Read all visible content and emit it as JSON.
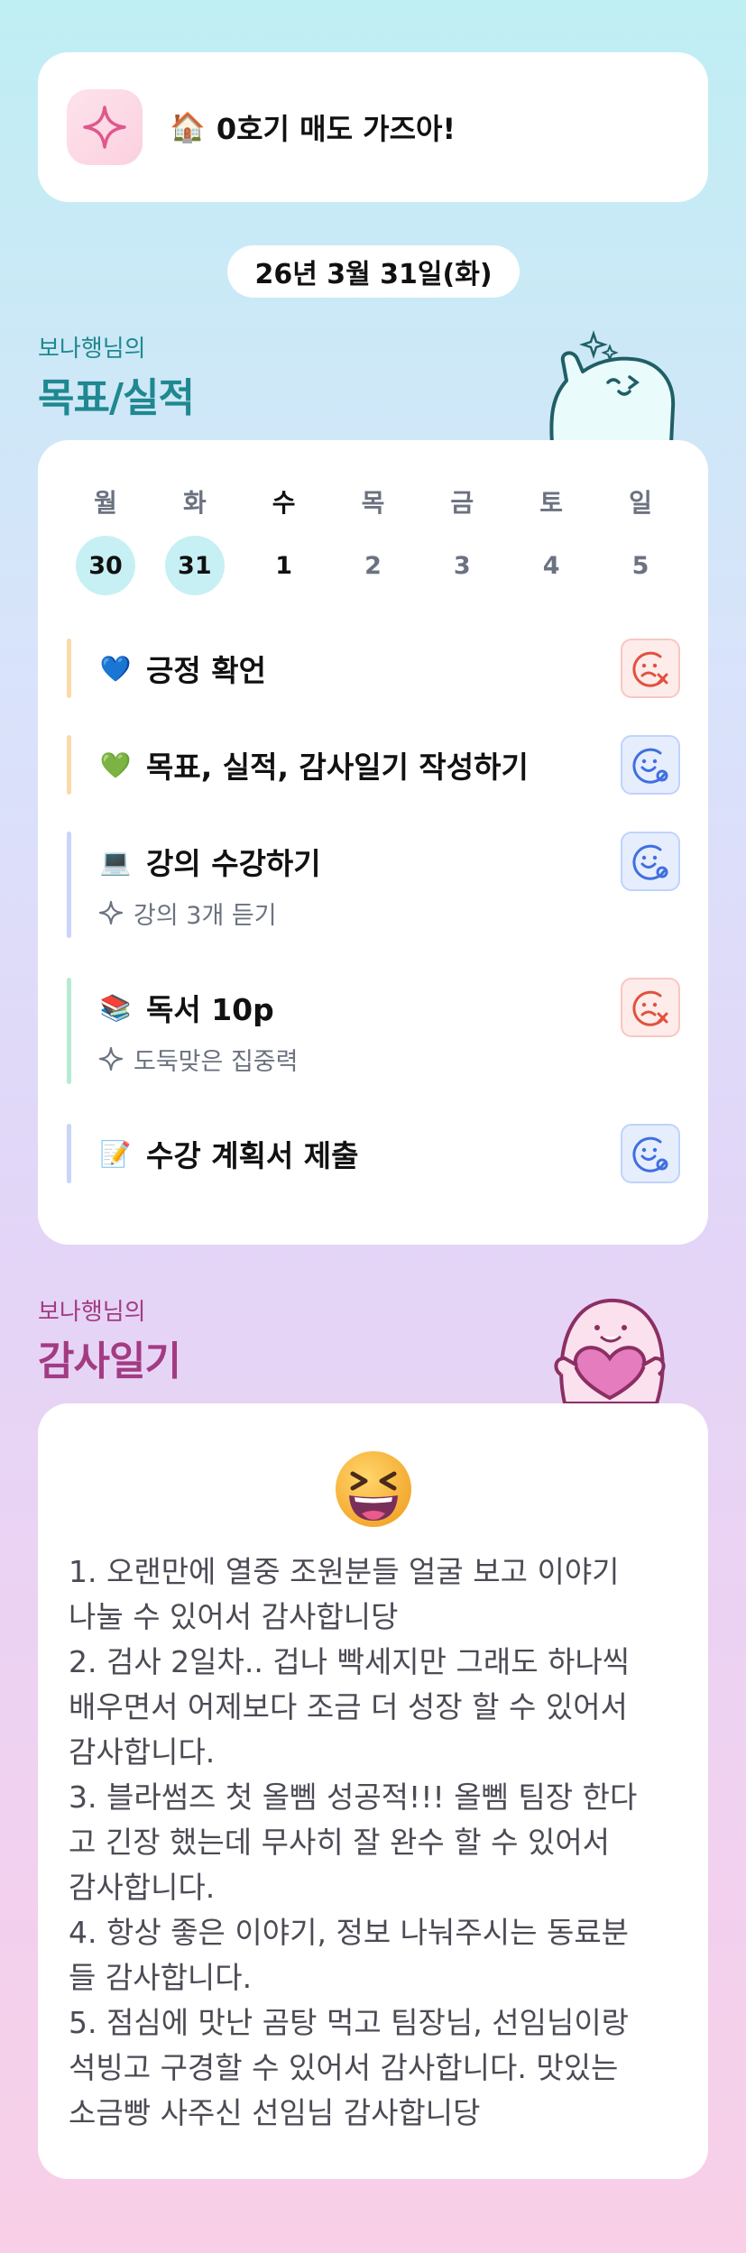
{
  "goal": {
    "icon": "sparkle-icon",
    "emoji": "🏠",
    "text": "0호기 매도 가즈아!"
  },
  "date": "26년 3월 31일(화)",
  "goals_section": {
    "subtitle": "보나행님의",
    "title": "목표/실적"
  },
  "week": {
    "days": [
      "월",
      "화",
      "수",
      "목",
      "금",
      "토",
      "일"
    ],
    "dates": [
      "30",
      "31",
      "1",
      "2",
      "3",
      "4",
      "5"
    ],
    "today_index": 2
  },
  "tasks": [
    {
      "emoji": "💙",
      "label": "긍정 확언",
      "sub": "",
      "status": "fail",
      "bar": "#fbd9a8"
    },
    {
      "emoji": "💚",
      "label": "목표, 실적, 감사일기 작성하기",
      "sub": "",
      "status": "ok",
      "bar": "#fbd9a8"
    },
    {
      "emoji": "💻",
      "label": "강의 수강하기",
      "sub": "강의 3개 듣기",
      "status": "ok",
      "bar": "#c9d4fb"
    },
    {
      "emoji": "📚",
      "label": "독서 10p",
      "sub": "도둑맞은 집중력",
      "status": "fail",
      "bar": "#b6ead2"
    },
    {
      "emoji": "📝",
      "label": "수강 계획서 제출",
      "sub": "",
      "status": "ok",
      "bar": "#c9d4fb"
    }
  ],
  "gratitude_section": {
    "subtitle": "보나행님의",
    "title": "감사일기"
  },
  "gratitude": {
    "mood_icon": "laughing-face-icon",
    "text": "1. 오랜만에 열중 조원분들 얼굴 보고 이야기\n나눌 수 있어서 감사합니당\n2. 검사 2일차.. 겁나 빡세지만 그래도 하나씩\n배우면서 어제보다 조금 더 성장 할 수 있어서\n감사합니다.\n3. 블라썸즈 첫 올뻼 성공적!!! 올뻼 팀장 한다\n고 긴장 했는데 무사히 잘 완수 할 수 있어서\n감사합니다.\n4. 항상 좋은 이야기, 정보 나눠주시는 동료분\n들 감사합니다.\n5. 점심에 맛난 곰탕 먹고 팀장님, 선임님이랑\n석빙고 구경할 수 있어서 감사합니다. 맛있는\n소금빵 사주신 선임님 감사합니당"
  },
  "colors": {
    "teal": "#1f8890",
    "purple": "#a33b83",
    "fail": "#e0523f",
    "ok": "#3f6fe0"
  }
}
